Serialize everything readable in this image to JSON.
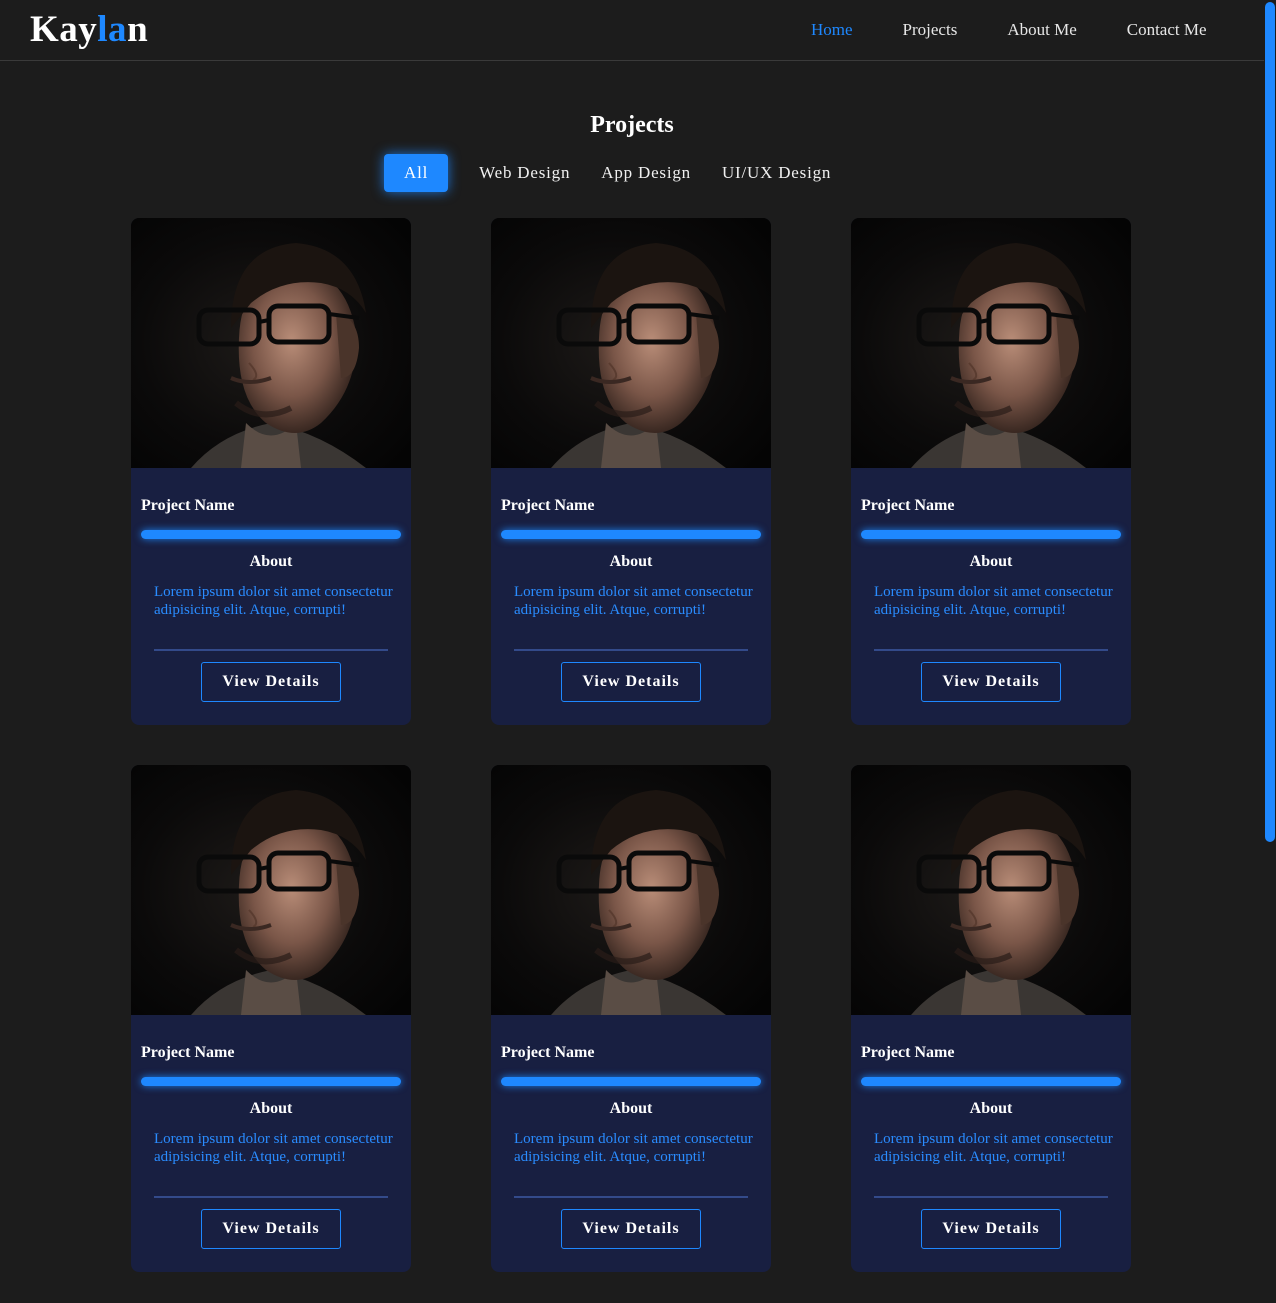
{
  "brand": {
    "prefix": "Kay",
    "accent": "la",
    "suffix": "n",
    "accent_color": "#1e88ff"
  },
  "nav": {
    "items": [
      {
        "label": "Home",
        "active": true
      },
      {
        "label": "Projects",
        "active": false
      },
      {
        "label": "About Me",
        "active": false
      },
      {
        "label": "Contact Me",
        "active": false
      }
    ]
  },
  "section": {
    "title": "Projects"
  },
  "filters": [
    {
      "label": "All",
      "active": true
    },
    {
      "label": "Web Design",
      "active": false
    },
    {
      "label": "App Design",
      "active": false
    },
    {
      "label": "UI/UX Design",
      "active": false
    }
  ],
  "cards": [
    {
      "name": "Project Name",
      "about_label": "About",
      "description": "Lorem ipsum dolor sit amet consectetur adipisicing elit. Atque, corrupti!",
      "button": "View Details"
    },
    {
      "name": "Project Name",
      "about_label": "About",
      "description": "Lorem ipsum dolor sit amet consectetur adipisicing elit. Atque, corrupti!",
      "button": "View Details"
    },
    {
      "name": "Project Name",
      "about_label": "About",
      "description": "Lorem ipsum dolor sit amet consectetur adipisicing elit. Atque, corrupti!",
      "button": "View Details"
    },
    {
      "name": "Project Name",
      "about_label": "About",
      "description": "Lorem ipsum dolor sit amet consectetur adipisicing elit. Atque, corrupti!",
      "button": "View Details"
    },
    {
      "name": "Project Name",
      "about_label": "About",
      "description": "Lorem ipsum dolor sit amet consectetur adipisicing elit. Atque, corrupti!",
      "button": "View Details"
    },
    {
      "name": "Project Name",
      "about_label": "About",
      "description": "Lorem ipsum dolor sit amet consectetur adipisicing elit. Atque, corrupti!",
      "button": "View Details"
    }
  ],
  "colors": {
    "background": "#1c1c1c",
    "card": "#181f41",
    "accent": "#1e88ff"
  }
}
